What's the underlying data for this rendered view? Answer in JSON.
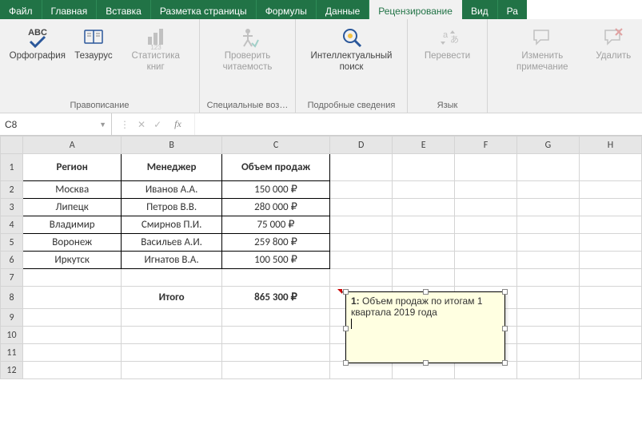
{
  "tabs": {
    "file": "Файл",
    "items": [
      "Главная",
      "Вставка",
      "Разметка страницы",
      "Формулы",
      "Данные",
      "Рецензирование",
      "Вид"
    ],
    "cut": "Ра",
    "active_index": 5
  },
  "ribbon": {
    "groups": [
      {
        "label": "Правописание",
        "items": [
          {
            "name": "spelling-button",
            "label": "Орфография",
            "disabled": false,
            "icon": "abc-check"
          },
          {
            "name": "thesaurus-button",
            "label": "Тезаурус",
            "disabled": false,
            "icon": "book"
          },
          {
            "name": "workbook-stats-button",
            "label": "Статистика книг",
            "disabled": true,
            "icon": "stats-123"
          }
        ]
      },
      {
        "label": "Специальные воз…",
        "items": [
          {
            "name": "check-accessibility-button",
            "label": "Проверить читаемость",
            "disabled": true,
            "icon": "accessibility"
          }
        ]
      },
      {
        "label": "Подробные сведения",
        "items": [
          {
            "name": "smart-lookup-button",
            "label": "Интеллектуальный поиск",
            "disabled": false,
            "icon": "magnifier"
          }
        ]
      },
      {
        "label": "Язык",
        "items": [
          {
            "name": "translate-button",
            "label": "Перевести",
            "disabled": true,
            "icon": "translate"
          }
        ]
      },
      {
        "label": "",
        "items": [
          {
            "name": "edit-comment-button",
            "label": "Изменить примечание",
            "disabled": true,
            "icon": "comment-edit"
          },
          {
            "name": "delete-comment-button",
            "label": "Удалить",
            "disabled": true,
            "icon": "comment-delete"
          }
        ]
      }
    ]
  },
  "namebox": {
    "value": "C8"
  },
  "fx_label": "fx",
  "columns": [
    "A",
    "B",
    "C",
    "D",
    "E",
    "F",
    "G",
    "H"
  ],
  "row_numbers": [
    1,
    2,
    3,
    4,
    5,
    6,
    7,
    8,
    9,
    10,
    11,
    12
  ],
  "headers": {
    "A": "Регион",
    "B": "Менеджер",
    "C": "Объем продаж"
  },
  "table": {
    "rows": [
      {
        "region": "Москва",
        "manager": "Иванов А.А.",
        "sales": "150 000 ₽"
      },
      {
        "region": "Липецк",
        "manager": "Петров В.В.",
        "sales": "280 000 ₽"
      },
      {
        "region": "Владимир",
        "manager": "Смирнов П.И.",
        "sales": "75 000 ₽"
      },
      {
        "region": "Воронеж",
        "manager": "Васильев А.И.",
        "sales": "259 800 ₽"
      },
      {
        "region": "Иркутск",
        "manager": "Игнатов В.А.",
        "sales": "100 500 ₽"
      }
    ],
    "total_label": "Итого",
    "total_value": "865 300 ₽"
  },
  "comment": {
    "author": "1:",
    "text": "Объем продаж по итогам 1 квартала 2019 года"
  }
}
